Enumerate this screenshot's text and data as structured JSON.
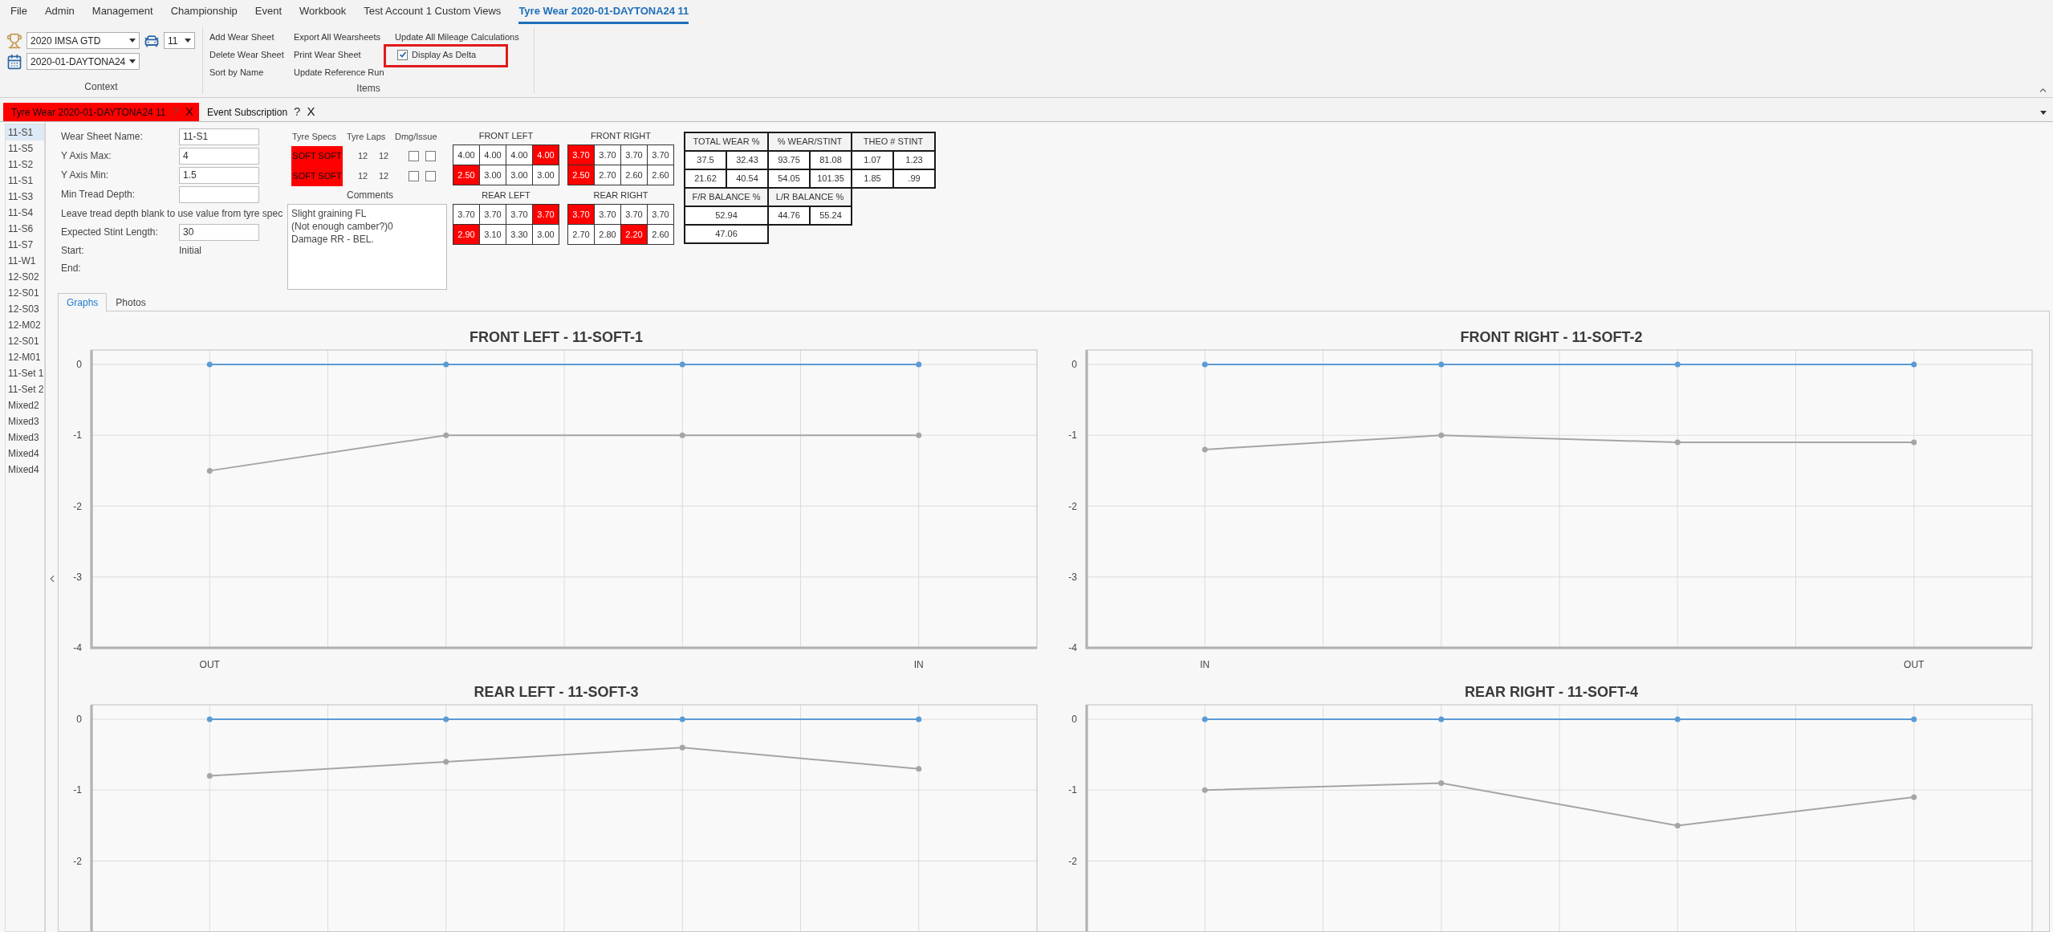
{
  "menu": [
    {
      "label": "File",
      "selected": false
    },
    {
      "label": "Admin",
      "selected": false
    },
    {
      "label": "Management",
      "selected": false
    },
    {
      "label": "Championship",
      "selected": false
    },
    {
      "label": "Event",
      "selected": false
    },
    {
      "label": "Workbook",
      "selected": false
    },
    {
      "label": "Test Account 1 Custom Views",
      "selected": false
    },
    {
      "label": "Tyre Wear 2020-01-DAYTONA24 11",
      "selected": true
    }
  ],
  "context": {
    "label": "Context",
    "championship": "2020 IMSA GTD",
    "car": "11",
    "event": "2020-01-DAYTONA24"
  },
  "items": {
    "label": "Items",
    "columns": [
      [
        {
          "kind": "action",
          "label": "Add Wear Sheet"
        },
        {
          "kind": "action",
          "label": "Delete Wear Sheet"
        },
        {
          "kind": "action",
          "label": "Sort by Name"
        }
      ],
      [
        {
          "kind": "action",
          "label": "Export All Wearsheets"
        },
        {
          "kind": "action",
          "label": "Print Wear Sheet"
        },
        {
          "kind": "action",
          "label": "Update Reference Run"
        }
      ],
      [
        {
          "kind": "action",
          "label": "Update All Mileage Calculations"
        },
        {
          "kind": "checkbox",
          "label": "Display As Delta",
          "checked": true
        }
      ]
    ]
  },
  "doc_tabs": [
    {
      "label": "Tyre Wear 2020-01-DAYTONA24 11",
      "selected": true,
      "help": "?",
      "close": "X"
    },
    {
      "label": "Event Subscription",
      "selected": false,
      "help": "?",
      "close": "X"
    }
  ],
  "sheets": [
    {
      "label": "11-S1",
      "selected": true
    },
    {
      "label": "11-S5",
      "selected": false
    },
    {
      "label": "11-S2",
      "selected": false
    },
    {
      "label": "11-S1",
      "selected": false
    },
    {
      "label": "11-S3",
      "selected": false
    },
    {
      "label": "11-S4",
      "selected": false
    },
    {
      "label": "11-S6",
      "selected": false
    },
    {
      "label": "11-S7",
      "selected": false
    },
    {
      "label": "11-W1",
      "selected": false
    },
    {
      "label": "12-S02",
      "selected": false
    },
    {
      "label": "12-S01",
      "selected": false
    },
    {
      "label": "12-S03",
      "selected": false
    },
    {
      "label": "12-M02",
      "selected": false
    },
    {
      "label": "12-S01",
      "selected": false
    },
    {
      "label": "12-M01",
      "selected": false
    },
    {
      "label": "11-Set 1",
      "selected": false
    },
    {
      "label": "11-Set 2",
      "selected": false
    },
    {
      "label": "Mixed2",
      "selected": false
    },
    {
      "label": "Mixed3",
      "selected": false
    },
    {
      "label": "Mixed3",
      "selected": false
    },
    {
      "label": "Mixed4",
      "selected": false
    },
    {
      "label": "Mixed4",
      "selected": false
    }
  ],
  "form": [
    {
      "kind": "input",
      "label": "Wear Sheet Name:",
      "value": "11-S1"
    },
    {
      "kind": "input",
      "label": "Y Axis Max:",
      "value": "4"
    },
    {
      "kind": "input",
      "label": "Y Axis Min:",
      "value": "1.5"
    },
    {
      "kind": "input",
      "label": "Min Tread Depth:"
    },
    {
      "kind": "note",
      "label": "Leave tread depth blank to use value from tyre spec"
    },
    {
      "kind": "input",
      "label": "Expected Stint Length:",
      "value": "30"
    },
    {
      "kind": "text",
      "label": "Start:",
      "value": "Initial"
    },
    {
      "kind": "text",
      "label": "End:"
    }
  ],
  "tyres": {
    "headers": [
      "Tyre Specs",
      "Tyre Laps",
      "Dmg/Issue"
    ],
    "rows": [
      {
        "specs": [
          {
            "value": "SOFT",
            "flagged": true
          },
          {
            "value": "SOFT",
            "flagged": true
          }
        ],
        "laps": [
          "12",
          "12"
        ],
        "damage": [
          {
            "checked": false
          },
          {
            "checked": false
          }
        ]
      },
      {
        "specs": [
          {
            "value": "SOFT",
            "flagged": true
          },
          {
            "value": "SOFT",
            "flagged": true
          }
        ],
        "laps": [
          "12",
          "12"
        ],
        "damage": [
          {
            "checked": false
          },
          {
            "checked": false
          }
        ]
      }
    ],
    "comments_label": "Comments",
    "comments": "Slight graining FL\n(Not enough camber?)0\nDamage RR - BEL."
  },
  "wear": [
    {
      "title": "FRONT LEFT",
      "rows": [
        [
          {
            "value": "4.00",
            "flagged": false
          },
          {
            "value": "4.00",
            "flagged": false
          },
          {
            "value": "4.00",
            "flagged": false
          },
          {
            "value": "4.00",
            "flagged": true
          }
        ],
        [
          {
            "value": "2.50",
            "flagged": true
          },
          {
            "value": "3.00",
            "flagged": false
          },
          {
            "value": "3.00",
            "flagged": false
          },
          {
            "value": "3.00",
            "flagged": false
          }
        ]
      ]
    },
    {
      "title": "FRONT RIGHT",
      "rows": [
        [
          {
            "value": "3.70",
            "flagged": true
          },
          {
            "value": "3.70",
            "flagged": false
          },
          {
            "value": "3.70",
            "flagged": false
          },
          {
            "value": "3.70",
            "flagged": false
          }
        ],
        [
          {
            "value": "2.50",
            "flagged": true
          },
          {
            "value": "2.70",
            "flagged": false
          },
          {
            "value": "2.60",
            "flagged": false
          },
          {
            "value": "2.60",
            "flagged": false
          }
        ]
      ]
    },
    {
      "title": "REAR LEFT",
      "rows": [
        [
          {
            "value": "3.70",
            "flagged": false
          },
          {
            "value": "3.70",
            "flagged": false
          },
          {
            "value": "3.70",
            "flagged": false
          },
          {
            "value": "3.70",
            "flagged": true
          }
        ],
        [
          {
            "value": "2.90",
            "flagged": true
          },
          {
            "value": "3.10",
            "flagged": false
          },
          {
            "value": "3.30",
            "flagged": false
          },
          {
            "value": "3.00",
            "flagged": false
          }
        ]
      ]
    },
    {
      "title": "REAR RIGHT",
      "rows": [
        [
          {
            "value": "3.70",
            "flagged": true
          },
          {
            "value": "3.70",
            "flagged": false
          },
          {
            "value": "3.70",
            "flagged": false
          },
          {
            "value": "3.70",
            "flagged": false
          }
        ],
        [
          {
            "value": "2.70",
            "flagged": false
          },
          {
            "value": "2.80",
            "flagged": false
          },
          {
            "value": "2.20",
            "flagged": true
          },
          {
            "value": "2.60",
            "flagged": false
          }
        ]
      ]
    }
  ],
  "stats": {
    "groups": [
      {
        "title": "TOTAL WEAR %",
        "rows": [
          [
            "37.5",
            "32.43"
          ],
          [
            "21.62",
            "40.54"
          ]
        ]
      },
      {
        "title": "% WEAR/STINT",
        "rows": [
          [
            "93.75",
            "81.08"
          ],
          [
            "54.05",
            "101.35"
          ]
        ]
      },
      {
        "title": "THEO # STINT",
        "rows": [
          [
            "1.07",
            "1.23"
          ],
          [
            "1.85",
            ".99"
          ]
        ]
      }
    ],
    "balance": [
      {
        "title": "F/R BALANCE %",
        "rows": [
          [
            "52.94"
          ],
          [
            "47.06"
          ]
        ]
      },
      {
        "title": "L/R BALANCE %",
        "rows": [
          [
            "44.76",
            "55.24"
          ]
        ]
      }
    ]
  },
  "view_tabs": [
    {
      "label": "Graphs",
      "selected": true
    },
    {
      "label": "Photos",
      "selected": false
    }
  ],
  "charts": [
    {
      "chart_data": {
        "type": "line",
        "title": "FRONT LEFT - 11-SOFT-1",
        "categories": [
          "OUT",
          null,
          null,
          "IN"
        ],
        "ylim": [
          -4,
          0
        ],
        "yticks": [
          0,
          -1,
          -2,
          -3,
          -4
        ],
        "grid": true,
        "series": [
          {
            "color": "#5b9bd5",
            "marker": true,
            "values": [
              0,
              0,
              0,
              0
            ]
          },
          {
            "color": "#a5a5a5",
            "marker": true,
            "values": [
              -1.5,
              -1,
              -1,
              -1
            ]
          }
        ]
      }
    },
    {
      "chart_data": {
        "type": "line",
        "title": "FRONT RIGHT - 11-SOFT-2",
        "categories": [
          "IN",
          null,
          null,
          "OUT"
        ],
        "ylim": [
          -4,
          0
        ],
        "yticks": [
          0,
          -1,
          -2,
          -3,
          -4
        ],
        "grid": true,
        "series": [
          {
            "color": "#5b9bd5",
            "marker": true,
            "values": [
              0,
              0,
              0,
              0
            ]
          },
          {
            "color": "#a5a5a5",
            "marker": true,
            "values": [
              -1.2,
              -1,
              -1.1,
              -1.1
            ]
          }
        ]
      }
    },
    {
      "chart_data": {
        "type": "line",
        "title": "REAR LEFT - 11-SOFT-3",
        "categories": [
          null,
          null,
          null,
          null
        ],
        "ylim": [
          -4,
          0
        ],
        "yticks": [
          0,
          -1,
          -2
        ],
        "grid": true,
        "series": [
          {
            "color": "#5b9bd5",
            "marker": true,
            "values": [
              0,
              0,
              0,
              0
            ]
          },
          {
            "color": "#a5a5a5",
            "marker": true,
            "values": [
              -0.8,
              -0.6,
              -0.4,
              -0.7
            ]
          }
        ]
      }
    },
    {
      "chart_data": {
        "type": "line",
        "title": "REAR RIGHT - 11-SOFT-4",
        "categories": [
          null,
          null,
          null,
          null
        ],
        "ylim": [
          -4,
          0
        ],
        "yticks": [
          0,
          -1,
          -2
        ],
        "grid": true,
        "series": [
          {
            "color": "#5b9bd5",
            "marker": true,
            "values": [
              0,
              0,
              0,
              0
            ]
          },
          {
            "color": "#a5a5a5",
            "marker": true,
            "values": [
              -1,
              -0.9,
              -1.5,
              -1.1
            ]
          }
        ]
      }
    }
  ]
}
